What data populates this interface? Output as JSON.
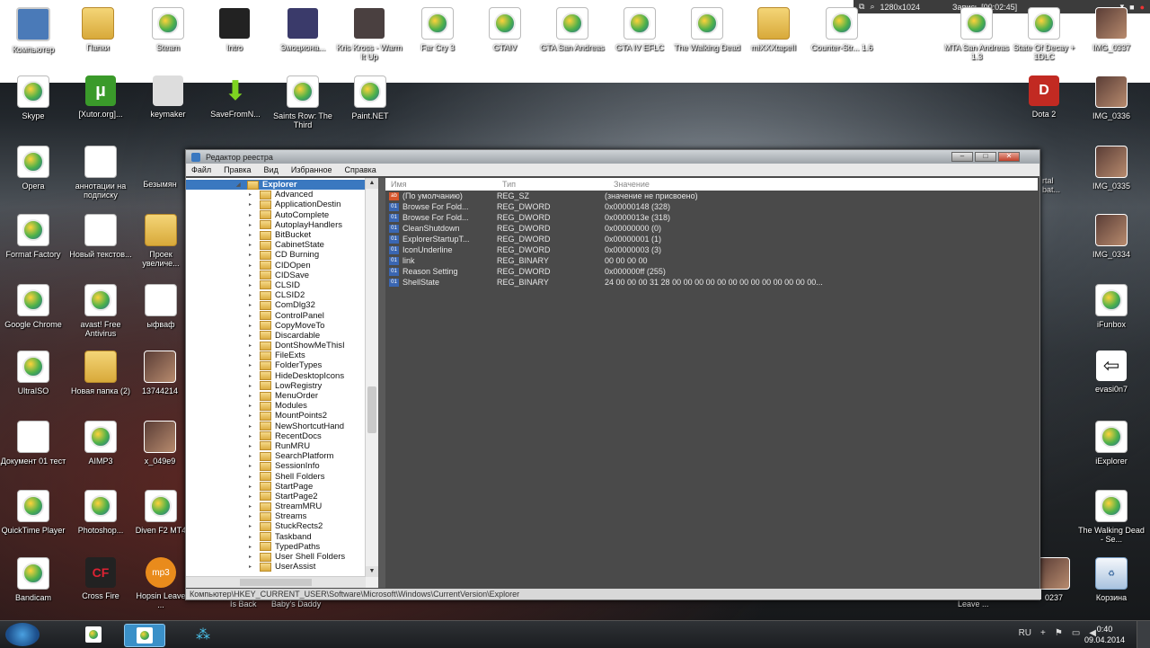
{
  "recorder": {
    "resolution": "1280x1024",
    "recording": "Запись [00:02:45]"
  },
  "desktop_icons": [
    {
      "label": "Компьютер"
    },
    {
      "label": "Папки"
    },
    {
      "label": "Steam"
    },
    {
      "label": "Intro"
    },
    {
      "label": "Эмоциона..."
    },
    {
      "label": "Kris Kross - Warm It Up"
    },
    {
      "label": "Far Cry 3"
    },
    {
      "label": "GTAIV"
    },
    {
      "label": "GTA San Andreas"
    },
    {
      "label": "GTA IV EFLC"
    },
    {
      "label": "The Walking Dead"
    },
    {
      "label": "miXXXtapeII"
    },
    {
      "label": "Counter-Str... 1.6"
    },
    {
      "label": "MTA San Andreas 1.3"
    },
    {
      "label": "State Of Decay + 1DLC"
    },
    {
      "label": "IMG_0337"
    },
    {
      "label": "Skype"
    },
    {
      "label": "[Xutor.org]..."
    },
    {
      "label": "keymaker"
    },
    {
      "label": "SaveFromN..."
    },
    {
      "label": "Saints Row: The Third"
    },
    {
      "label": "Paint.NET"
    },
    {
      "label": "Dota 2"
    },
    {
      "label": "IMG_0336"
    },
    {
      "label": "Opera"
    },
    {
      "label": "аннотации на подписку"
    },
    {
      "label": "Безымян"
    },
    {
      "label": "IMG_0335"
    },
    {
      "label": "Format Factory"
    },
    {
      "label": "Новый текстов..."
    },
    {
      "label": "Проек увеличе..."
    },
    {
      "label": "IMG_0334"
    },
    {
      "label": "Google Chrome"
    },
    {
      "label": "avast! Free Antivirus"
    },
    {
      "label": "ыфваф"
    },
    {
      "label": "iFunbox"
    },
    {
      "label": "UltraISO"
    },
    {
      "label": "Новая папка (2)"
    },
    {
      "label": "13744214"
    },
    {
      "label": "evasi0n7"
    },
    {
      "label": "Документ 01 тест"
    },
    {
      "label": "AIMP3"
    },
    {
      "label": "x_049e9"
    },
    {
      "label": "iExplorer"
    },
    {
      "label": "QuickTime Player"
    },
    {
      "label": "Photoshop..."
    },
    {
      "label": "Diven F2 MT4"
    },
    {
      "label": "The Walking Dead - Se..."
    },
    {
      "label": "Bandicam"
    },
    {
      "label": "Cross Fire"
    },
    {
      "label": "Hopsin Leave ..."
    },
    {
      "label": "0237"
    },
    {
      "label": "Корзина"
    }
  ],
  "bg_fragments": {
    "b1": "Is Back",
    "b2": "Baby's Daddy",
    "b3": "Leave ...",
    "b4": "rtal bat..."
  },
  "regedit": {
    "title": "Редактор реестра",
    "menu": [
      "Файл",
      "Правка",
      "Вид",
      "Избранное",
      "Справка"
    ],
    "tree": {
      "selected": "Explorer",
      "items": [
        "Advanced",
        "ApplicationDestin",
        "AutoComplete",
        "AutoplayHandlers",
        "BitBucket",
        "CabinetState",
        "CD Burning",
        "CIDOpen",
        "CIDSave",
        "CLSID",
        "CLSID2",
        "ComDlg32",
        "ControlPanel",
        "CopyMoveTo",
        "Discardable",
        "DontShowMeThisI",
        "FileExts",
        "FolderTypes",
        "HideDesktopIcons",
        "LowRegistry",
        "MenuOrder",
        "Modules",
        "MountPoints2",
        "NewShortcutHand",
        "RecentDocs",
        "RunMRU",
        "SearchPlatform",
        "SessionInfo",
        "Shell Folders",
        "StartPage",
        "StartPage2",
        "StreamMRU",
        "Streams",
        "StuckRects2",
        "Taskband",
        "TypedPaths",
        "User Shell Folders",
        "UserAssist"
      ]
    },
    "columns": [
      "Имя",
      "Тип",
      "Значение"
    ],
    "values": [
      {
        "name": "(По умолчанию)",
        "type": "REG_SZ",
        "data": "(значение не присвоено)",
        "kind": "str"
      },
      {
        "name": "Browse For Fold...",
        "type": "REG_DWORD",
        "data": "0x00000148 (328)",
        "kind": "bin"
      },
      {
        "name": "Browse For Fold...",
        "type": "REG_DWORD",
        "data": "0x0000013e (318)",
        "kind": "bin"
      },
      {
        "name": "CleanShutdown",
        "type": "REG_DWORD",
        "data": "0x00000000 (0)",
        "kind": "bin"
      },
      {
        "name": "ExplorerStartupT...",
        "type": "REG_DWORD",
        "data": "0x00000001 (1)",
        "kind": "bin"
      },
      {
        "name": "IconUnderline",
        "type": "REG_DWORD",
        "data": "0x00000003 (3)",
        "kind": "bin"
      },
      {
        "name": "link",
        "type": "REG_BINARY",
        "data": "00 00 00 00",
        "kind": "bin"
      },
      {
        "name": "Reason Setting",
        "type": "REG_DWORD",
        "data": "0x000000ff (255)",
        "kind": "bin"
      },
      {
        "name": "ShellState",
        "type": "REG_BINARY",
        "data": "24 00 00 00 31 28 00 00 00 00 00 00 00 00 00 00 00 00 00...",
        "kind": "bin"
      }
    ],
    "status_path": "Компьютер\\HKEY_CURRENT_USER\\Software\\Microsoft\\Windows\\CurrentVersion\\Explorer"
  },
  "taskbar": {
    "lang": "RU",
    "time": "0:40",
    "date": "09.04.2014"
  },
  "colors": {
    "accent": "#3a78c0",
    "selection": "#3a78c0"
  }
}
